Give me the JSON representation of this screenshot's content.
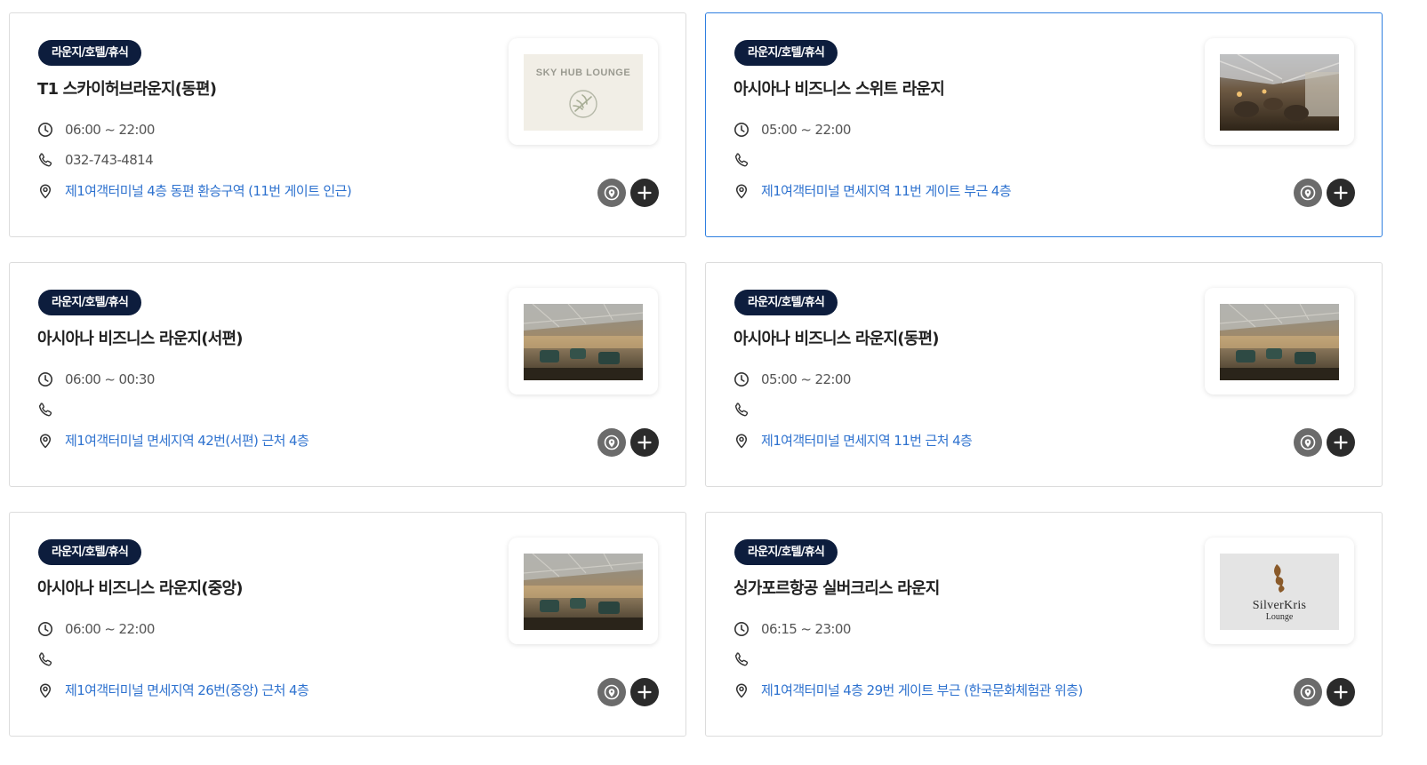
{
  "cards": [
    {
      "category": "라운지/호텔/휴식",
      "title": "T1 스카이허브라운지(동편)",
      "hours": "06:00 ~ 22:00",
      "phone": "032-743-4814",
      "address": "제1여객터미널 4층 동편 환승구역 (11번 게이트 인근)",
      "thumb_type": "skyhub",
      "thumb_logo_text": "SKY HUB LOUNGE",
      "selected": false
    },
    {
      "category": "라운지/호텔/휴식",
      "title": "아시아나 비즈니스 스위트 라운지",
      "hours": "05:00 ~ 22:00",
      "phone": "",
      "address": "제1여객터미널 면세지역 11번 게이트 부근 4층",
      "thumb_type": "photo-suite",
      "selected": true
    },
    {
      "category": "라운지/호텔/휴식",
      "title": "아시아나 비즈니스 라운지(서편)",
      "hours": "06:00 ~ 00:30",
      "phone": "",
      "address": "제1여객터미널 면세지역 42번(서편) 근처 4층",
      "thumb_type": "photo-lounge",
      "selected": false
    },
    {
      "category": "라운지/호텔/휴식",
      "title": "아시아나 비즈니스 라운지(동편)",
      "hours": "05:00 ~ 22:00",
      "phone": "",
      "address": "제1여객터미널 면세지역 11번 근처 4층",
      "thumb_type": "photo-lounge",
      "selected": false
    },
    {
      "category": "라운지/호텔/휴식",
      "title": "아시아나 비즈니스 라운지(중앙)",
      "hours": "06:00 ~ 22:00",
      "phone": "",
      "address": "제1여객터미널 면세지역 26번(중앙) 근처 4층",
      "thumb_type": "photo-lounge",
      "selected": false
    },
    {
      "category": "라운지/호텔/휴식",
      "title": "싱가포르항공 실버크리스 라운지",
      "hours": "06:15 ~ 23:00",
      "phone": "",
      "address": "제1여객터미널 4층 29번 게이트 부근 (한국문화체험관 위층)",
      "thumb_type": "silverkris",
      "thumb_logo_text": "SilverKris",
      "thumb_logo_sub": "Lounge",
      "selected": false
    }
  ],
  "icons": {
    "hours": "clock-icon",
    "phone": "phone-icon",
    "address": "location-pin-icon",
    "map_button": "map-pin-icon",
    "add_button": "plus-icon"
  },
  "colors": {
    "badge_bg": "#0d1d3d",
    "address_link": "#2e72cf",
    "selected_border": "#2f7fe0",
    "map_button": "#6b6b6b",
    "add_button": "#2b2b2b"
  }
}
